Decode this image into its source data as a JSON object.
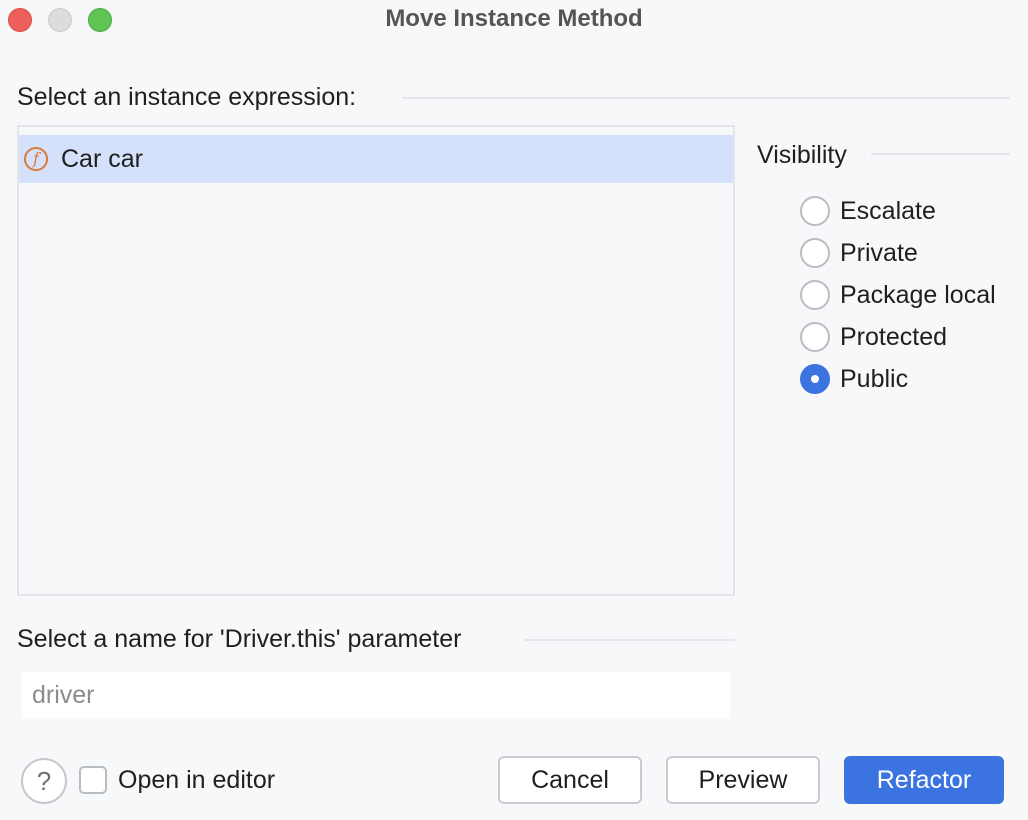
{
  "window": {
    "title": "Move Instance Method",
    "controls": {
      "close_color": "#ec5f5a",
      "minimize_color": "#dcdcdc",
      "maximize_color": "#5fc454"
    }
  },
  "instance_section": {
    "label": "Select an instance expression:",
    "items": [
      {
        "icon": "field-icon",
        "icon_glyph": "f",
        "label": "Car car",
        "selected": true
      }
    ]
  },
  "visibility": {
    "label": "Visibility",
    "options": [
      {
        "label": "Escalate",
        "checked": false
      },
      {
        "label": "Private",
        "checked": false
      },
      {
        "label": "Package local",
        "checked": false
      },
      {
        "label": "Protected",
        "checked": false
      },
      {
        "label": "Public",
        "checked": true
      }
    ]
  },
  "parameter_section": {
    "label": "Select a name for 'Driver.this' parameter",
    "input_value": "",
    "input_placeholder": "driver"
  },
  "footer": {
    "help_glyph": "?",
    "open_in_editor_label": "Open in editor",
    "open_in_editor_checked": false,
    "cancel_label": "Cancel",
    "preview_label": "Preview",
    "refactor_label": "Refactor"
  },
  "colors": {
    "accent": "#3b74e0",
    "selection": "#d5e1fa",
    "field_icon": "#d97a35"
  }
}
